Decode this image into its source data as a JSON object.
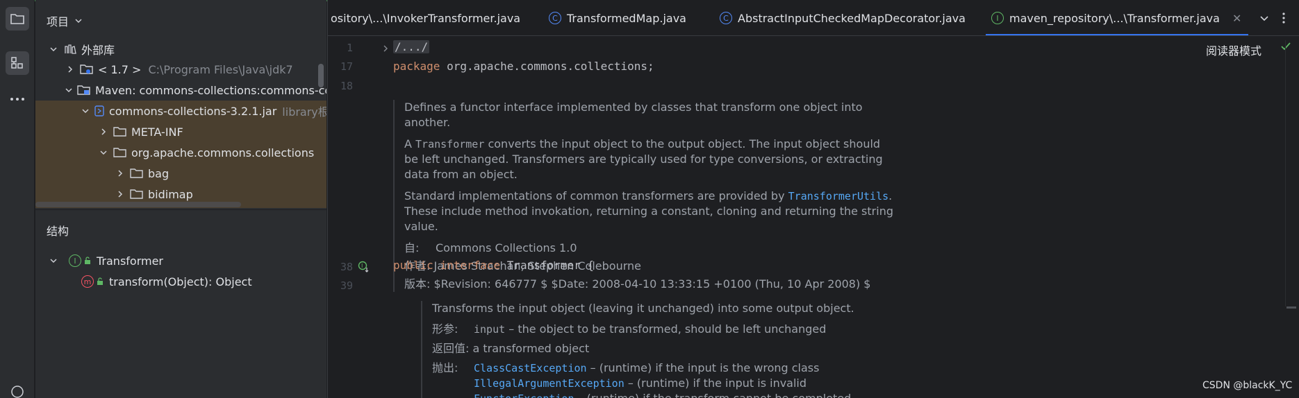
{
  "project_panel": {
    "title": "项目",
    "tree": [
      {
        "label": "外部库",
        "suffix": ""
      },
      {
        "label": "< 1.7 >",
        "suffix": "C:\\Program Files\\Java\\jdk7"
      },
      {
        "label": "Maven: commons-collections:commons-co",
        "suffix": ""
      },
      {
        "label": "commons-collections-3.2.1.jar",
        "suffix": "library根"
      },
      {
        "label": "META-INF",
        "suffix": ""
      },
      {
        "label": "org.apache.commons.collections",
        "suffix": ""
      },
      {
        "label": "bag",
        "suffix": ""
      },
      {
        "label": "bidimap",
        "suffix": ""
      }
    ]
  },
  "structure_panel": {
    "title": "结构",
    "items": [
      {
        "label": "Transformer"
      },
      {
        "label": "transform(Object): Object"
      }
    ]
  },
  "tabs": [
    {
      "label": "ository\\...\\InvokerTransformer.java",
      "icon": "c-icon"
    },
    {
      "label": "TransformedMap.java",
      "icon": "class-icon"
    },
    {
      "label": "AbstractInputCheckedMapDecorator.java",
      "icon": "class-icon"
    },
    {
      "label": "maven_repository\\...\\Transformer.java",
      "icon": "interface-icon",
      "active": true
    }
  ],
  "editor": {
    "line_numbers": [
      "1",
      "17",
      "18",
      "38",
      "39"
    ],
    "fold": "/.../",
    "package_kw": "package",
    "package_name": " org.apache.commons.collections;",
    "class_doc": {
      "p1": "Defines a functor interface implemented by classes that transform one object into another.",
      "p2_a": "A ",
      "p2_code": "Transformer",
      "p2_b": " converts the input object to the output object. The input object should be left unchanged. Transformers are typically used for type conversions, or extracting data from an object.",
      "p3_a": "Standard implementations of common transformers are provided by ",
      "p3_link": "TransformerUtils",
      "p3_b": ". These include method invokation, returning a constant, cloning and returning the string value.",
      "since_label": "自:",
      "since_value": "Commons Collections 1.0",
      "author_label": "作者:",
      "author_value": "James Strachan, Stephen Colebourne",
      "version_label": "版本:",
      "version_value": "$Revision: 646777 $ $Date: 2008-04-10 13:33:15 +0100 (Thu, 10 Apr 2008) $"
    },
    "decl_public": "public",
    "decl_interface": "interface",
    "decl_name": " Transformer {",
    "method_doc": {
      "summary": "Transforms the input object (leaving it unchanged) into some output object.",
      "param_label": "形参:",
      "param_name": "input",
      "param_desc": " – the object to be transformed, should be left unchanged",
      "return_label": "返回值:",
      "return_value": "a transformed object",
      "throws_label": "抛出:",
      "throws": [
        {
          "name": "ClassCastException",
          "desc": " – (runtime) if the input is the wrong class"
        },
        {
          "name": "IllegalArgumentException",
          "desc": " – (runtime) if the input is invalid"
        },
        {
          "name": "FunctorException",
          "desc": " – (runtime) if the transform cannot be completed"
        }
      ]
    },
    "reader_mode": "阅读器模式"
  },
  "watermark": "CSDN @blackK_YC",
  "colors": {
    "accent": "#3574f0",
    "keyword": "#cf8e6d",
    "link": "#56a8f5",
    "library_row": "#4a3f2f"
  }
}
